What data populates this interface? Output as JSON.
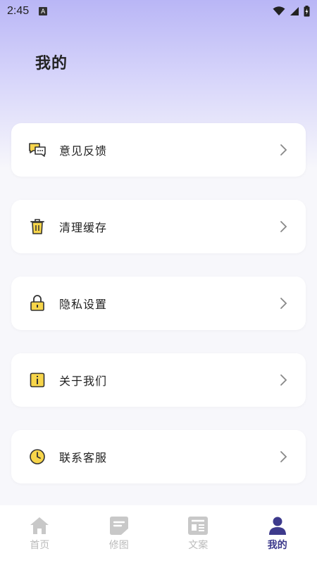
{
  "status_bar": {
    "time": "2:45",
    "notification_glyph": "A"
  },
  "page": {
    "title": "我的"
  },
  "menu": {
    "items": [
      {
        "label": "意见反馈",
        "icon": "feedback-chat-icon"
      },
      {
        "label": "清理缓存",
        "icon": "trash-icon"
      },
      {
        "label": "隐私设置",
        "icon": "lock-icon"
      },
      {
        "label": "关于我们",
        "icon": "info-icon"
      },
      {
        "label": "联系客服",
        "icon": "clock-icon"
      }
    ]
  },
  "tabbar": {
    "tabs": [
      {
        "label": "首页",
        "icon": "home-icon",
        "active": false
      },
      {
        "label": "修图",
        "icon": "edit-doc-icon",
        "active": false
      },
      {
        "label": "文案",
        "icon": "article-icon",
        "active": false
      },
      {
        "label": "我的",
        "icon": "user-icon",
        "active": true
      }
    ]
  },
  "colors": {
    "accent": "#3d3a8c",
    "icon_yellow": "#f7d54a",
    "icon_stroke": "#333333",
    "inactive_tab": "#bbbbbb",
    "gradient_top": "#b9b6f6"
  }
}
